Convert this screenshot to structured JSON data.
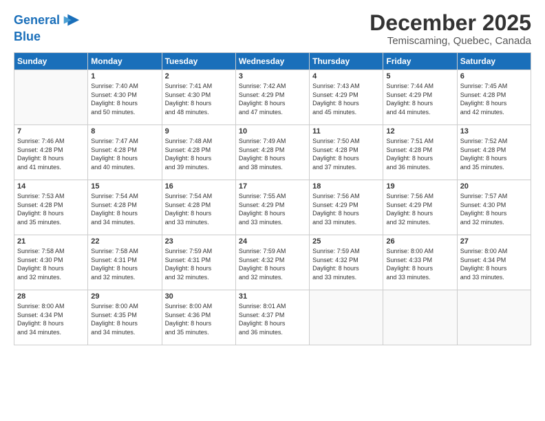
{
  "header": {
    "logo_line1": "General",
    "logo_line2": "Blue",
    "month": "December 2025",
    "location": "Temiscaming, Quebec, Canada"
  },
  "days_of_week": [
    "Sunday",
    "Monday",
    "Tuesday",
    "Wednesday",
    "Thursday",
    "Friday",
    "Saturday"
  ],
  "weeks": [
    [
      {
        "day": "",
        "info": ""
      },
      {
        "day": "1",
        "info": "Sunrise: 7:40 AM\nSunset: 4:30 PM\nDaylight: 8 hours\nand 50 minutes."
      },
      {
        "day": "2",
        "info": "Sunrise: 7:41 AM\nSunset: 4:30 PM\nDaylight: 8 hours\nand 48 minutes."
      },
      {
        "day": "3",
        "info": "Sunrise: 7:42 AM\nSunset: 4:29 PM\nDaylight: 8 hours\nand 47 minutes."
      },
      {
        "day": "4",
        "info": "Sunrise: 7:43 AM\nSunset: 4:29 PM\nDaylight: 8 hours\nand 45 minutes."
      },
      {
        "day": "5",
        "info": "Sunrise: 7:44 AM\nSunset: 4:29 PM\nDaylight: 8 hours\nand 44 minutes."
      },
      {
        "day": "6",
        "info": "Sunrise: 7:45 AM\nSunset: 4:28 PM\nDaylight: 8 hours\nand 42 minutes."
      }
    ],
    [
      {
        "day": "7",
        "info": "Sunrise: 7:46 AM\nSunset: 4:28 PM\nDaylight: 8 hours\nand 41 minutes."
      },
      {
        "day": "8",
        "info": "Sunrise: 7:47 AM\nSunset: 4:28 PM\nDaylight: 8 hours\nand 40 minutes."
      },
      {
        "day": "9",
        "info": "Sunrise: 7:48 AM\nSunset: 4:28 PM\nDaylight: 8 hours\nand 39 minutes."
      },
      {
        "day": "10",
        "info": "Sunrise: 7:49 AM\nSunset: 4:28 PM\nDaylight: 8 hours\nand 38 minutes."
      },
      {
        "day": "11",
        "info": "Sunrise: 7:50 AM\nSunset: 4:28 PM\nDaylight: 8 hours\nand 37 minutes."
      },
      {
        "day": "12",
        "info": "Sunrise: 7:51 AM\nSunset: 4:28 PM\nDaylight: 8 hours\nand 36 minutes."
      },
      {
        "day": "13",
        "info": "Sunrise: 7:52 AM\nSunset: 4:28 PM\nDaylight: 8 hours\nand 35 minutes."
      }
    ],
    [
      {
        "day": "14",
        "info": "Sunrise: 7:53 AM\nSunset: 4:28 PM\nDaylight: 8 hours\nand 35 minutes."
      },
      {
        "day": "15",
        "info": "Sunrise: 7:54 AM\nSunset: 4:28 PM\nDaylight: 8 hours\nand 34 minutes."
      },
      {
        "day": "16",
        "info": "Sunrise: 7:54 AM\nSunset: 4:28 PM\nDaylight: 8 hours\nand 33 minutes."
      },
      {
        "day": "17",
        "info": "Sunrise: 7:55 AM\nSunset: 4:29 PM\nDaylight: 8 hours\nand 33 minutes."
      },
      {
        "day": "18",
        "info": "Sunrise: 7:56 AM\nSunset: 4:29 PM\nDaylight: 8 hours\nand 33 minutes."
      },
      {
        "day": "19",
        "info": "Sunrise: 7:56 AM\nSunset: 4:29 PM\nDaylight: 8 hours\nand 32 minutes."
      },
      {
        "day": "20",
        "info": "Sunrise: 7:57 AM\nSunset: 4:30 PM\nDaylight: 8 hours\nand 32 minutes."
      }
    ],
    [
      {
        "day": "21",
        "info": "Sunrise: 7:58 AM\nSunset: 4:30 PM\nDaylight: 8 hours\nand 32 minutes."
      },
      {
        "day": "22",
        "info": "Sunrise: 7:58 AM\nSunset: 4:31 PM\nDaylight: 8 hours\nand 32 minutes."
      },
      {
        "day": "23",
        "info": "Sunrise: 7:59 AM\nSunset: 4:31 PM\nDaylight: 8 hours\nand 32 minutes."
      },
      {
        "day": "24",
        "info": "Sunrise: 7:59 AM\nSunset: 4:32 PM\nDaylight: 8 hours\nand 32 minutes."
      },
      {
        "day": "25",
        "info": "Sunrise: 7:59 AM\nSunset: 4:32 PM\nDaylight: 8 hours\nand 33 minutes."
      },
      {
        "day": "26",
        "info": "Sunrise: 8:00 AM\nSunset: 4:33 PM\nDaylight: 8 hours\nand 33 minutes."
      },
      {
        "day": "27",
        "info": "Sunrise: 8:00 AM\nSunset: 4:34 PM\nDaylight: 8 hours\nand 33 minutes."
      }
    ],
    [
      {
        "day": "28",
        "info": "Sunrise: 8:00 AM\nSunset: 4:34 PM\nDaylight: 8 hours\nand 34 minutes."
      },
      {
        "day": "29",
        "info": "Sunrise: 8:00 AM\nSunset: 4:35 PM\nDaylight: 8 hours\nand 34 minutes."
      },
      {
        "day": "30",
        "info": "Sunrise: 8:00 AM\nSunset: 4:36 PM\nDaylight: 8 hours\nand 35 minutes."
      },
      {
        "day": "31",
        "info": "Sunrise: 8:01 AM\nSunset: 4:37 PM\nDaylight: 8 hours\nand 36 minutes."
      },
      {
        "day": "",
        "info": ""
      },
      {
        "day": "",
        "info": ""
      },
      {
        "day": "",
        "info": ""
      }
    ]
  ]
}
